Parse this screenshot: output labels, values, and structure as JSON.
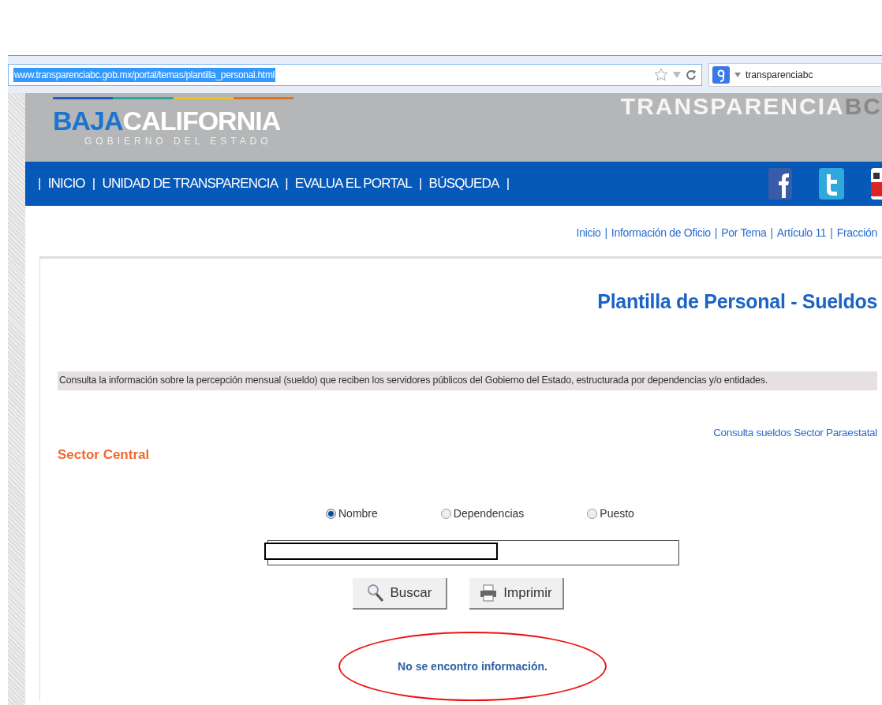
{
  "browser": {
    "url": "www.transparenciabc.gob.mx/portal/temas/plantilla_personal.html",
    "search_value": "transparenciabc"
  },
  "header": {
    "logo_primary": "BAJA",
    "logo_secondary": "CALIFORNIA",
    "logo_subtitle": "GOBIERNO DEL ESTADO",
    "banner_title": "TRANSPARENCIA",
    "banner_suffix": "BC"
  },
  "nav": {
    "separator": "|",
    "items": [
      "INICIO",
      "UNIDAD DE TRANSPARENCIA",
      "EVALUA EL PORTAL",
      "BÚSQUEDA"
    ]
  },
  "breadcrumb": {
    "separator": "|",
    "items": [
      "Inicio",
      "Información de Oficio",
      "Por Tema",
      "Artículo 11",
      "Fracción"
    ]
  },
  "title": "Plantilla de Personal - Sueldos",
  "description": "Consulta la información sobre la percepción mensual (sueldo) que reciben los servidores públicos del Gobierno del Estado, estructurada por dependencias y/o entidades.",
  "parastatal_link": "Consulta sueldos Sector Paraestatal",
  "section_title": "Sector Central",
  "search_options": [
    {
      "label": "Nombre",
      "selected": true
    },
    {
      "label": "Dependencias",
      "selected": false
    },
    {
      "label": "Puesto",
      "selected": false
    }
  ],
  "search_field": {
    "redacted": true
  },
  "buttons": [
    {
      "label": "Buscar",
      "kind": "search"
    },
    {
      "label": "Imprimir",
      "kind": "print"
    }
  ],
  "message": "No se encontro información.",
  "message_circled": true
}
